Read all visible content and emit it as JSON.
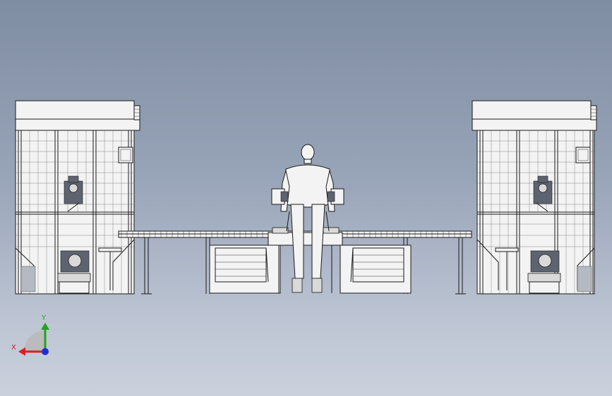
{
  "view": {
    "background_top": "#7f8da2",
    "background_bottom": "#cbd1dc"
  },
  "triad": {
    "x_label": "X",
    "y_label": "Y",
    "x_color": "#d42121",
    "y_color": "#1fa31f",
    "z_color": "#1b2fd6"
  },
  "scene_parts": [
    "left-robot-cell",
    "right-robot-cell",
    "conveyor",
    "left-fixture-table",
    "right-fixture-table",
    "human-figure"
  ]
}
